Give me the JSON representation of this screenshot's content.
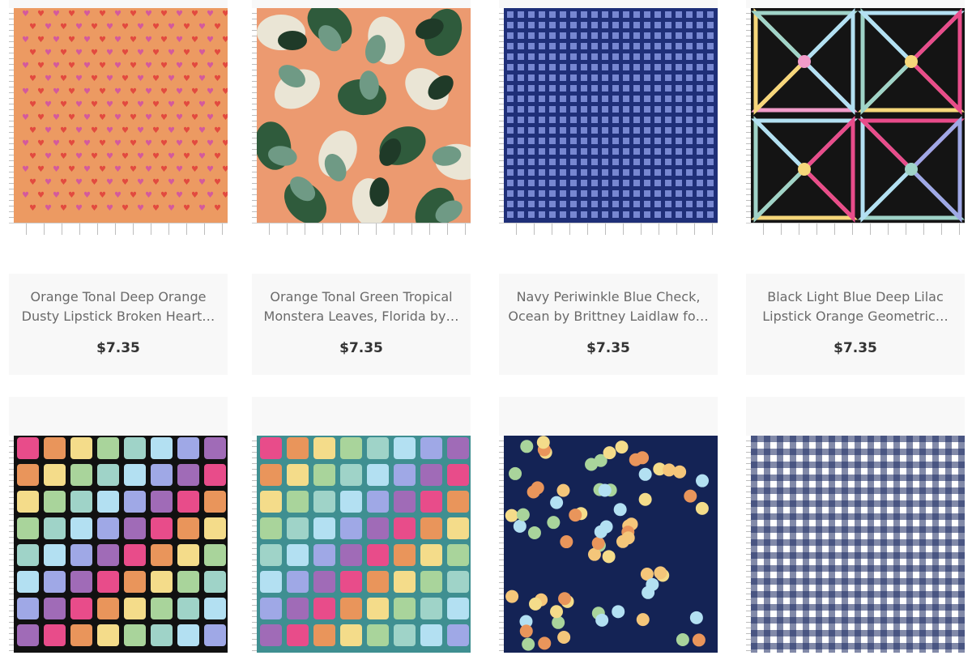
{
  "products": [
    {
      "title": "Orange Tonal Deep Orange Dusty Lipstick Broken Heart…",
      "price": "$7.35",
      "pattern": "hearts",
      "colors": {
        "bg": "#ec9a62",
        "a": "#e24a3f",
        "b": "#d45a9c"
      }
    },
    {
      "title": "Orange Tonal Green Tropical Monstera Leaves, Florida by…",
      "price": "$7.35",
      "pattern": "monstera",
      "colors": {
        "bg": "#ec9a70",
        "leaf": "#2f5b3c",
        "leaf2": "#eae5d5"
      }
    },
    {
      "title": "Navy Periwinkle Blue Check, Ocean by Brittney Laidlaw fo…",
      "price": "$7.35",
      "pattern": "check",
      "colors": {
        "bg": "#1f2f78",
        "sq": "#8797e0"
      }
    },
    {
      "title": "Black Light Blue Deep Lilac Lipstick Orange Geometric…",
      "price": "$7.35",
      "pattern": "geometric",
      "colors": {
        "bg": "#141414"
      }
    },
    {
      "pattern": "rainbow-squares",
      "colors": {
        "bg": "#111111"
      }
    },
    {
      "pattern": "rainbow-squares",
      "colors": {
        "bg": "#3f8f91"
      }
    },
    {
      "pattern": "dots",
      "colors": {
        "bg": "#142355"
      }
    },
    {
      "pattern": "gingham",
      "colors": {
        "bg": "#ffffff",
        "line": "#1c2a63"
      }
    }
  ]
}
